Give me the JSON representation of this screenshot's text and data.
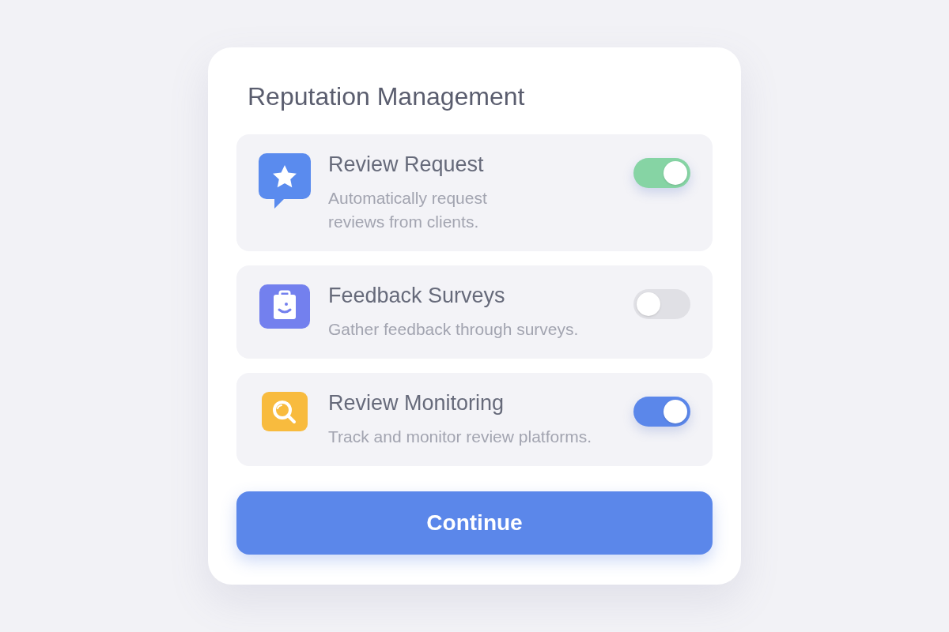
{
  "title": "Reputation Management",
  "items": [
    {
      "kind": "star-bubble",
      "name": "Review Request",
      "description_lines": [
        "Automatically request",
        "reviews from clients."
      ],
      "on": true,
      "color": "#86d4a4"
    },
    {
      "kind": "clipboard",
      "name": "Feedback Surveys",
      "description_lines": [
        "Gather feedback through surveys."
      ],
      "on": false
    },
    {
      "kind": "search",
      "name": "Review Monitoring",
      "description_lines": [
        "Track and monitor review platforms."
      ],
      "on": true,
      "color": "#5b87ea"
    }
  ],
  "button": "Continue"
}
